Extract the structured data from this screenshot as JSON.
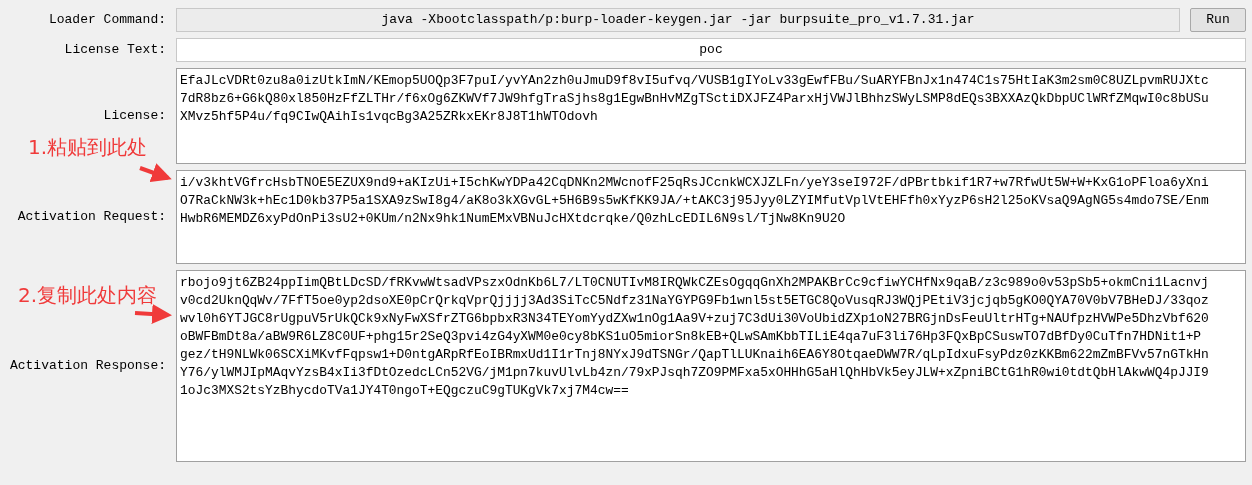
{
  "loader_command": {
    "label": "Loader Command:",
    "value": "java -Xbootclasspath/p:burp-loader-keygen.jar -jar burpsuite_pro_v1.7.31.jar",
    "button": "Run"
  },
  "license_text": {
    "label": "License Text:",
    "value": "poc"
  },
  "text_areas": [
    {
      "label": "License:",
      "lines": [
        "EfaJLcVDRt0zu8a0izUtkImN/KEmop5UOQp3F7puI/yvYAn2zh0uJmuD9f8vI5ufvq/VUSB1gIYoLv33gEwfFBu/SuARYFBnJx1n474C1s75HtIaK3m2sm0C8UZLpvmRUJXtc",
        "7dR8bz6+G6kQ80xl850HzFfZLTHr/f6xOg6ZKWVf7JW9hfgTraSjhs8g1EgwBnHvMZgTSctiDXJFZ4ParxHjVWJlBhhzSWyLSMP8dEQs3BXXAzQkDbpUClWRfZMqwI0c8bUSu",
        "XMvz5hf5P4u/fq9CIwQAihIs1vqcBg3A25ZRkxEKr8J8T1hWTOdovh"
      ]
    },
    {
      "label": "Activation Request:",
      "lines": [
        "i/v3khtVGfrcHsbTNOE5EZUX9nd9+aKIzUi+I5chKwYDPa42CqDNKn2MWcnofF25qRsJCcnkWCXJZLFn/yeY3seI972F/dPBrtbkif1R7+w7RfwUt5W+W+KxG1oPFloa6yXni",
        "O7RaCkNW3k+hEc1D0kb37P5a1SXA9zSwI8g4/aK8o3kXGvGL+5H6B9s5wKfKK9JA/+tAKC3j95Jyy0LZYIMfutVplVtEHFfh0xYyzP6sH2l25oKVsaQ9AgNG5s4mdo7SE/Enm",
        "HwbR6MEMDZ6xyPdOnPi3sU2+0KUm/n2Nx9hk1NumEMxVBNuJcHXtdcrqke/Q0zhLcEDIL6N9sl/TjNw8Kn9U2O"
      ]
    },
    {
      "label": "Activation Response:",
      "lines": [
        "rbojo9jt6ZB24ppIimQBtLDcSD/fRKvwWtsadVPszxOdnKb6L7/LT0CNUTIvM8IRQWkCZEsOgqqGnXh2MPAKBrCc9cfiwYCHfNx9qaB/z3c989o0v53pSb5+okmCni1Lacnvj",
        "v0cd2UknQqWv/7FfT5oe0yp2dsoXE0pCrQrkqVprQjjjj3Ad3SiTcC5Ndfz31NaYGYPG9Fb1wnl5st5ETGC8QoVusqRJ3WQjPEtiV3jcjqb5gKO0QYA70V0bV7BHeDJ/33qoz",
        "wvl0h6YTJGC8rUgpuV5rUkQCk9xNyFwXSfrZTG6bpbxR3N34TEYomYydZXw1nOg1Aa9V+zuj7C3dUi30VoUbidZXp1oN27BRGjnDsFeuUltrHTg+NAUfpzHVWPe5DhzVbf620",
        "oBWFBmDt8a/aBW9R6LZ8C0UF+phg15r2SeQ3pvi4zG4yXWM0e0cy8bKS1uO5miorSn8kEB+QLwSAmKbbTILiE4qa7uF3li76Hp3FQxBpCSuswTO7dBfDy0CuTfn7HDNit1+P",
        "gez/tH9NLWk06SCXiMKvfFqpsw1+D0ntgARpRfEoIBRmxUd1I1rTnj8NYxJ9dTSNGr/QapTlLUKnaih6EA6Y8OtqaeDWW7R/qLpIdxuFsyPdz0zKKBm622mZmBFVv57nGTkHn",
        "Y76/ylWMJIpMAqvYzsB4xIi3fDtOzedcLCn52VG/jM1pn7kuvUlvLb4zn/79xPJsqh7ZO9PMFxa5xOHHhG5aHlQhHbVk5eyJLW+xZpniBCtG1hR0wi0tdtQbHlAkwWQ4pJJI9",
        "1oJc3MXS2tsYzBhycdoTVa1JY4T0ngoT+EQgczuC9gTUKgVk7xj7M4cw=="
      ]
    }
  ],
  "annotations": [
    "1.粘贴到此处",
    "2.复制此处内容"
  ]
}
